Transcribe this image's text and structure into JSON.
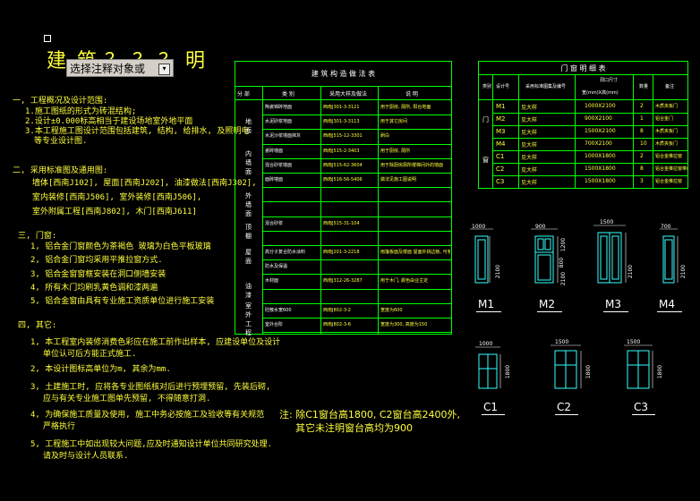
{
  "title_chars": [
    "建",
    "筑",
    "？",
    "？",
    "？",
    "明"
  ],
  "layer_combo": {
    "value": "选择注释对象或",
    "arrow": "▾"
  },
  "notes": {
    "s1_head": "一, 工程概况及设计范围:",
    "s1_l1": "1.施工图纸的形式为砖混结构;",
    "s1_l2": "2.设计±0.000标高相当于建设场地室外地平面",
    "s1_l3": "3.本工程施工图设计范围包括建筑, 结构, 给排水, 及照明电",
    "s1_l4": "等专业设计图.",
    "s2_head": "二, 采用标准图及通用图:",
    "s2_l1": "墙体[西南J102], 屋面[西南J202], 油漆做法[西南J302],",
    "s2_l2": "室内装修[西南J506], 室外装修[西南J506],",
    "s2_l3": "室外附属工程[西南J802], 木门[西南J611]",
    "s3_head": "三, 门窗:",
    "s3_l1": "1, 铝合金门窗颜色为茶褐色 玻璃为白色平板玻璃",
    "s3_l2": "2, 铝合金门窗均采用平推拉窗方式.",
    "s3_l3": "3, 铝合金窗窗框安装在洞口侧墙安装",
    "s3_l4": "4, 所有木门均刷乳黄色调和漆两遍",
    "s3_l5": "5, 铝合金窗由具有专业施工资质单位进行施工安装",
    "s4_head": "四, 其它:",
    "s4_l1": "1, 本工程室内装修消费色彩应在施工前作出样本, 应建设单位及设计",
    "s4_l1b": "单位认可后方能正式施工.",
    "s4_l2": "2, 本设计图标高单位为m, 其余为mm.",
    "s4_l3": "3, 土建施工时, 应将各专业图纸核对后进行预埋预留, 先装后砌,",
    "s4_l3b": "应与有关专业施工图单先预留, 不得随意打洞.",
    "s4_l4": "4, 为确保施工质量及使用, 施工中务必按施工及验收等有关规范",
    "s4_l4b": "严格执行",
    "s4_l5": "5, 工程施工中如出现较大问题,应及时通知设计单位共同研究处理.",
    "s4_l5b": "请及时与设计人员联系."
  },
  "tech_table": {
    "title": "建 筑 构 造 做 法 表",
    "headers": [
      "分 部",
      "类 别",
      "采用大样及做法",
      "说 明"
    ],
    "groups": [
      "地面",
      "内墙面",
      "外墙面",
      "顶棚",
      "屋面",
      "油漆",
      "室外工程"
    ],
    "rows": [
      [
        "陶瓷锦砖地面",
        "西南J301-3-3121",
        "用于厨房, 厕所, 阳台地面"
      ],
      [
        "水泥砂浆地面",
        "西南J301-3-3113",
        "用于其它房间"
      ],
      [
        "水泥沙浆墙面抹灰",
        "西南J515-12-3301",
        "刷白"
      ],
      [
        "瓷砖墙面",
        "西南J515-2-3403",
        "用于厨房, 厕所"
      ],
      [
        "混合砂浆墙面",
        "西南J515-62-3604",
        "用于除厨房厕所楼梯间外的墙面"
      ],
      [
        "面砖墙面",
        "西南J516-56-5406",
        "做法见施工图说明"
      ],
      [
        "",
        "",
        ""
      ],
      [
        "",
        "",
        ""
      ],
      [
        "混合砂浆",
        "西南J515-31-104",
        ""
      ],
      [
        "",
        "",
        ""
      ],
      [
        "高分子复合防水涂料",
        "西南J201-3-2218",
        "雨篷板面及楼面 屋面外挑边板, 可参考楼板作法"
      ],
      [
        "防水及保温",
        "",
        ""
      ],
      [
        "木材面",
        "西南J312-26-3287",
        "用于木门, 颜色由业主定"
      ],
      [
        "",
        "",
        ""
      ],
      [
        "砼散水宽600",
        "西南J802-3-2",
        "宽度为600"
      ],
      [
        "室外台阶",
        "西南J802-3-6",
        "宽度为300, 高度为150"
      ]
    ]
  },
  "door_table": {
    "title": "门 窗 明 细 表",
    "col_labels": [
      "类别",
      "设计号",
      "采用标准图集及编号",
      "洞口尺寸",
      "宽(mm)X高(mm)",
      "数量",
      "备注"
    ],
    "group_labels": [
      "门",
      "窗"
    ],
    "rows": [
      [
        "M1",
        "见大样",
        "1000X2100",
        "2",
        "木质夹板门"
      ],
      [
        "M2",
        "见大样",
        "900X2100",
        "1",
        "铝合金门"
      ],
      [
        "M3",
        "见大样",
        "1500X2100",
        "8",
        "木质夹板门"
      ],
      [
        "M4",
        "见大样",
        "700X2100",
        "10",
        "木质夹板门"
      ],
      [
        "C1",
        "见大样",
        "1000X1800",
        "2",
        "铝合金推拉窗"
      ],
      [
        "C2",
        "见大样",
        "1500X1800",
        "8",
        "铝合金推拉窗带纱窗"
      ],
      [
        "C3",
        "见大样",
        "1500X1800",
        "3",
        "铝合金推拉窗"
      ]
    ]
  },
  "elevations": {
    "labels": [
      "M1",
      "M2",
      "M3",
      "M4",
      "C1",
      "C2",
      "C3"
    ],
    "dims": {
      "m1_w": "1000",
      "m1_h": "2100",
      "m2_w": "900",
      "m2_h1": "1200",
      "m2_h2": "800",
      "m2_h3": "2100",
      "m3_w": "1500",
      "m3_h": "2100",
      "m4_w": "700",
      "m4_h": "2100",
      "c1_w": "1000",
      "c1_h": "1800",
      "c2_w": "1500",
      "c2_h": "1800",
      "c3_w": "1500",
      "c3_h": "1800"
    }
  },
  "footnote": {
    "l1": "注: 除C1窗台高1800, C2窗台高2400外,",
    "l2": "其它未注明窗台高均为900"
  }
}
